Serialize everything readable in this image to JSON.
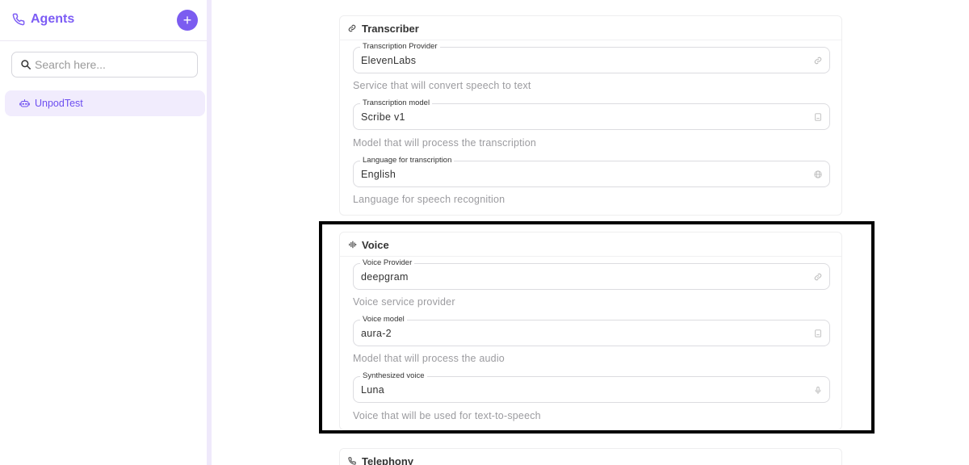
{
  "sidebar": {
    "title": "Agents",
    "add_label": "+",
    "search_placeholder": "Search here...",
    "items": [
      {
        "label": "UnpodTest"
      }
    ]
  },
  "transcriber": {
    "title": "Transcriber",
    "fields": [
      {
        "label": "Transcription Provider",
        "value": "ElevenLabs",
        "helper": "Service that will convert speech to text",
        "icon": "link-icon"
      },
      {
        "label": "Transcription model",
        "value": "Scribe v1",
        "helper": "Model that will process the transcription",
        "icon": "chip-icon"
      },
      {
        "label": "Language for transcription",
        "value": "English",
        "helper": "Language for speech recognition",
        "icon": "globe-icon"
      }
    ]
  },
  "voice": {
    "title": "Voice",
    "fields": [
      {
        "label": "Voice Provider",
        "value": "deepgram",
        "helper": "Voice service provider",
        "icon": "link-icon"
      },
      {
        "label": "Voice model",
        "value": "aura-2",
        "helper": "Model that will process the audio",
        "icon": "chip-icon"
      },
      {
        "label": "Synthesized voice",
        "value": "Luna",
        "helper": "Voice that will be used for text-to-speech",
        "icon": "microphone-icon"
      }
    ]
  },
  "telephony": {
    "title": "Telephony"
  },
  "colors": {
    "accent": "#7b5cf0",
    "highlight": "#000000"
  }
}
